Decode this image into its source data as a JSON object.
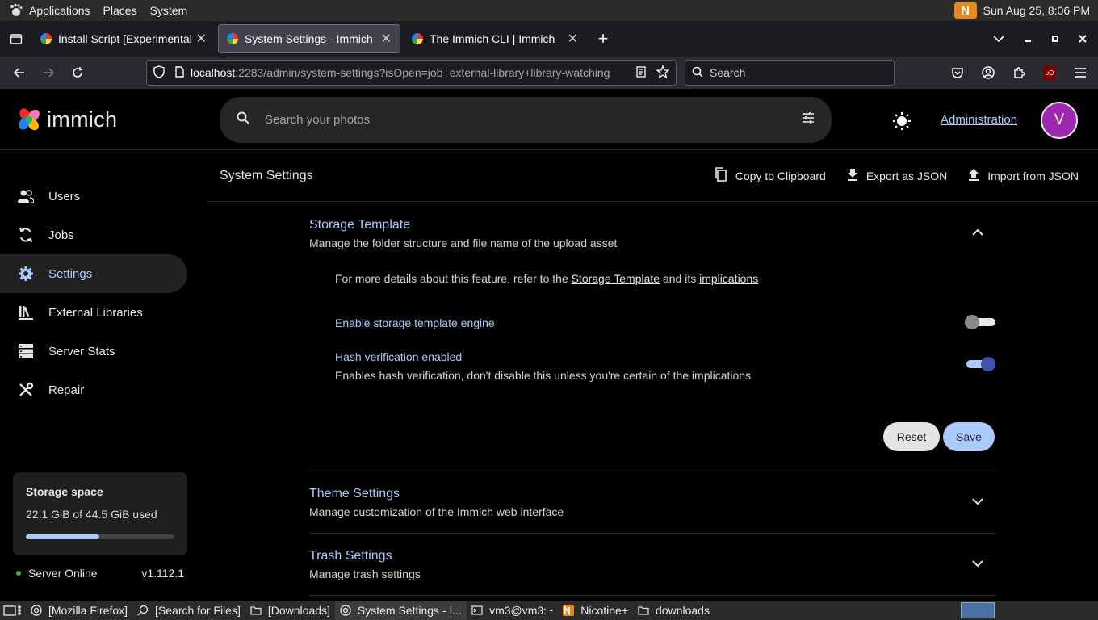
{
  "gnome": {
    "applications": "Applications",
    "places": "Places",
    "system": "System",
    "clock": "Sun Aug 25,  8:06 PM",
    "nicotine_glyph": "N"
  },
  "browser": {
    "tabs": [
      {
        "title": "Install Script [Experimental]",
        "active": false
      },
      {
        "title": "System Settings - Immich",
        "active": true
      },
      {
        "title": "The Immich CLI | Immich",
        "active": false
      }
    ],
    "url_host": "localhost",
    "url_rest": ":2283/admin/system-settings?isOpen=job+external-library+library-watching",
    "search_placeholder": "Search"
  },
  "header": {
    "brand": "immich",
    "search_placeholder": "Search your photos",
    "admin_link": "Administration",
    "avatar_letter": "V"
  },
  "sidebar": {
    "items": [
      {
        "label": "Users",
        "icon": "users-icon",
        "active": false
      },
      {
        "label": "Jobs",
        "icon": "sync-icon",
        "active": false
      },
      {
        "label": "Settings",
        "icon": "gear-icon",
        "active": true
      },
      {
        "label": "External Libraries",
        "icon": "library-icon",
        "active": false
      },
      {
        "label": "Server Stats",
        "icon": "server-icon",
        "active": false
      },
      {
        "label": "Repair",
        "icon": "wrench-icon",
        "active": false
      }
    ],
    "storage": {
      "title": "Storage space",
      "usage": "22.1 GiB of 44.5 GiB used",
      "fraction": 0.497
    },
    "server": {
      "status": "Server Online",
      "version": "v1.112.1"
    }
  },
  "main": {
    "title": "System Settings",
    "actions": {
      "copy": "Copy to Clipboard",
      "export": "Export as JSON",
      "import": "Import from JSON"
    },
    "storage_template": {
      "title": "Storage Template",
      "subtitle": "Manage the folder structure and file name of the upload asset",
      "info_prefix": "For more details about this feature, refer to the",
      "info_link1": "Storage Template",
      "info_mid": "and its",
      "info_link2": "implications",
      "enable_label": "Enable storage template engine",
      "enable_on": false,
      "hash_label": "Hash verification enabled",
      "hash_desc": "Enables hash verification, don't disable this unless you're certain of the implications",
      "hash_on": true,
      "reset": "Reset",
      "save": "Save"
    },
    "theme": {
      "title": "Theme Settings",
      "subtitle": "Manage customization of the Immich web interface"
    },
    "trash": {
      "title": "Trash Settings",
      "subtitle": "Manage trash settings"
    }
  },
  "taskbar": {
    "items": [
      {
        "label": "[Mozilla Firefox]",
        "icon": "firefox-icon"
      },
      {
        "label": "[Search for Files]",
        "icon": "search-files-icon"
      },
      {
        "label": "[Downloads]",
        "icon": "folder-icon"
      },
      {
        "label": "System Settings - I...",
        "icon": "firefox-icon"
      },
      {
        "label": "vm3@vm3:~",
        "icon": "terminal-icon"
      },
      {
        "label": "Nicotine+",
        "icon": "nicotine-icon"
      },
      {
        "label": "downloads",
        "icon": "folder-icon"
      }
    ]
  },
  "colors": {
    "accent": "#adcbfa",
    "avatar": "#9c27b0",
    "toggle_on": "#4250af",
    "online": "#4caf50"
  }
}
